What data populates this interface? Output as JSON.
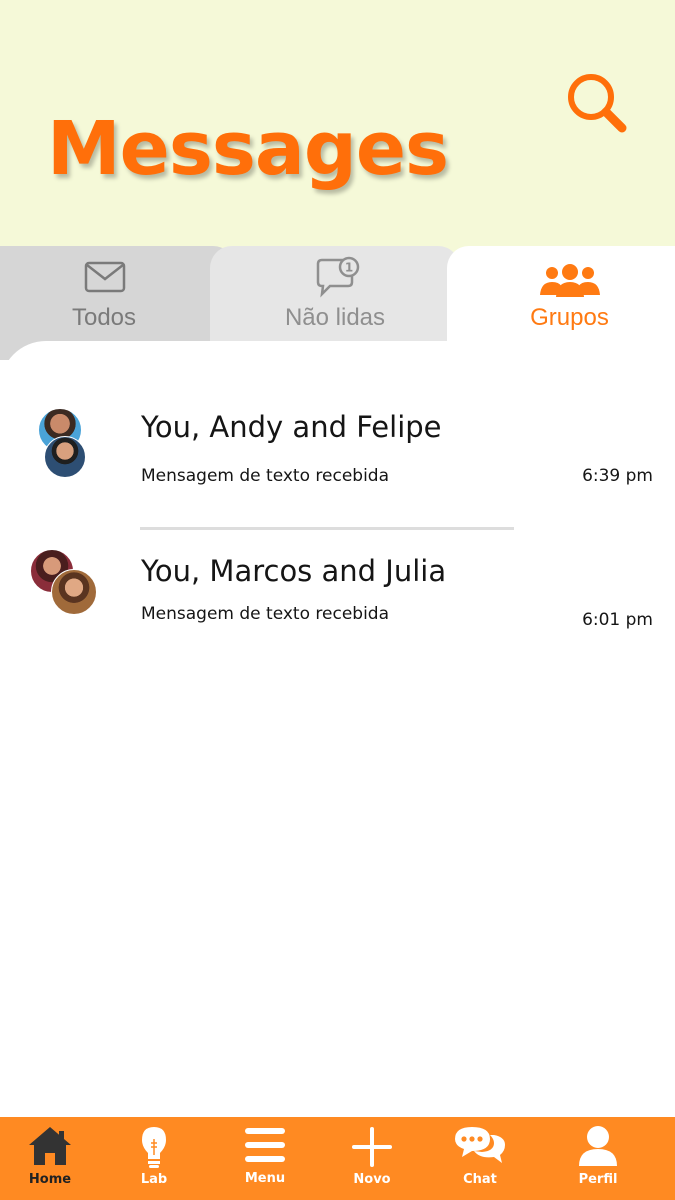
{
  "header": {
    "title": "Messages",
    "search_icon": "search-icon"
  },
  "tabs": [
    {
      "label": "Todos",
      "icon": "envelope-icon",
      "active": false
    },
    {
      "label": "Não lidas",
      "icon": "chat-bubble-badge-icon",
      "badge": "1",
      "active": false
    },
    {
      "label": "Grupos",
      "icon": "group-icon",
      "active": true
    }
  ],
  "conversations": [
    {
      "title": "You, Andy and Felipe",
      "preview": "Mensagem de texto recebida",
      "time": "6:39 pm"
    },
    {
      "title": "You, Marcos and Julia",
      "preview": "Mensagem de texto recebida",
      "time": "6:01 pm"
    }
  ],
  "nav": [
    {
      "label": "Home",
      "icon": "home-icon"
    },
    {
      "label": "Lab",
      "icon": "lightbulb-icon"
    },
    {
      "label": "Menu",
      "icon": "menu-icon"
    },
    {
      "label": "Novo",
      "icon": "plus-icon"
    },
    {
      "label": "Chat",
      "icon": "chat-icon"
    },
    {
      "label": "Perfil",
      "icon": "profile-icon"
    }
  ],
  "colors": {
    "accent": "#ff6f0a",
    "header_bg": "#f5f9d8",
    "nav_bg": "#ff8a22"
  }
}
